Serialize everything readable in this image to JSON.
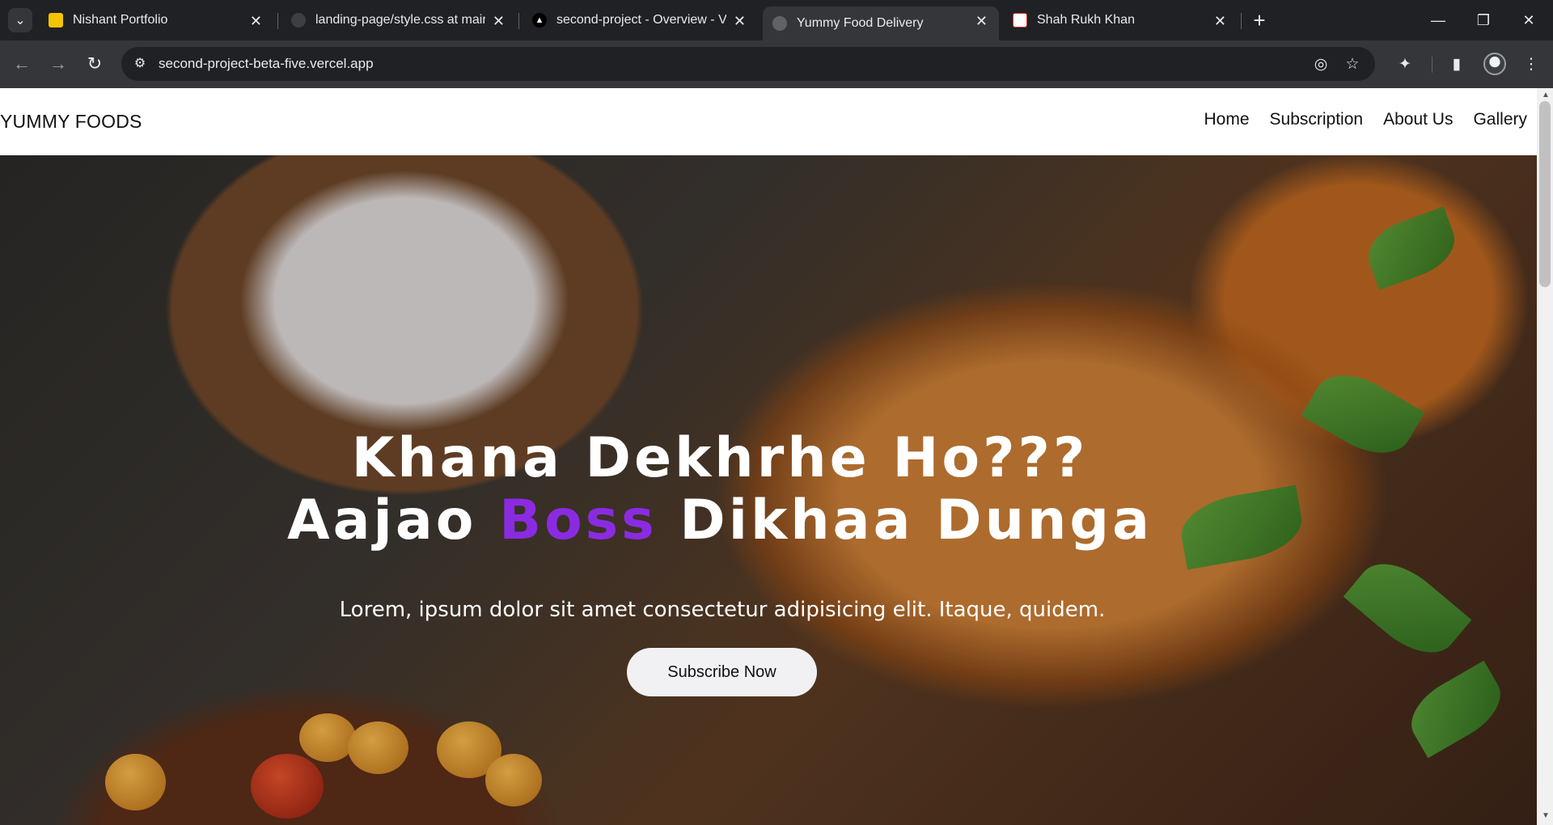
{
  "browser": {
    "tabs": [
      {
        "title": "Nishant Portfolio",
        "favicon_color": "#f5c400",
        "active": false
      },
      {
        "title": "landing-page/style.css at main",
        "favicon_color": "#3c4043",
        "active": false
      },
      {
        "title": "second-project - Overview - Ver",
        "favicon_color": "#000000",
        "active": false
      },
      {
        "title": "Yummy Food Delivery",
        "favicon_color": "#5f6368",
        "active": true
      },
      {
        "title": "Shah Rukh Khan",
        "favicon_color": "#e0302a",
        "active": false
      }
    ],
    "url": "second-project-beta-five.vercel.app",
    "icons": {
      "tab_search": "chevron-down-icon",
      "new_tab": "plus-icon",
      "minimize": "minimize-icon",
      "restore": "restore-icon",
      "close": "close-icon",
      "back": "arrow-left-icon",
      "forward": "arrow-right-icon",
      "reload": "reload-icon",
      "site_info": "tune-icon",
      "eye_off": "eye-off-icon",
      "bookmark": "star-icon",
      "extensions": "puzzle-icon",
      "side_panel": "side-panel-icon",
      "menu": "more-vert-icon"
    }
  },
  "site": {
    "logo": "YUMMY FOODS",
    "nav": [
      "Home",
      "Subscription",
      "About Us",
      "Gallery"
    ],
    "hero": {
      "line1": "Khana Dekhrhe Ho???",
      "line2_start": "Aajao ",
      "line2_accent": "Boss",
      "line2_end": " Dikhaa Dunga",
      "accent_color": "#8a2be2",
      "subtitle": "Lorem, ipsum dolor sit amet consectetur adipisicing elit. Itaque, quidem.",
      "cta": "Subscribe Now"
    }
  }
}
